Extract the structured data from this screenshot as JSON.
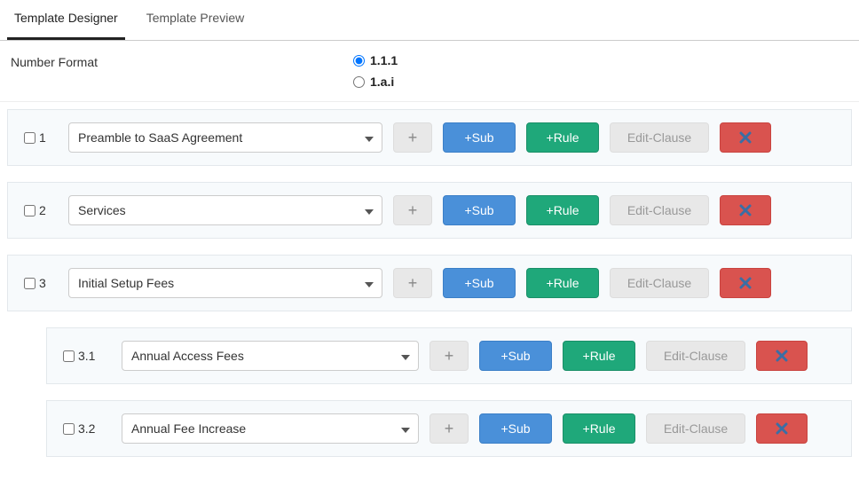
{
  "tabs": {
    "designer": "Template Designer",
    "preview": "Template Preview"
  },
  "numberFormat": {
    "label": "Number Format",
    "opt1": "1.1.1",
    "opt2": "1.a.i"
  },
  "buttons": {
    "plus": "+",
    "sub": "+Sub",
    "rule": "+Rule",
    "edit": "Edit-Clause"
  },
  "clauses": [
    {
      "num": "1",
      "title": "Preamble to SaaS Agreement"
    },
    {
      "num": "2",
      "title": "Services"
    },
    {
      "num": "3",
      "title": "Initial Setup Fees"
    }
  ],
  "subclauses": [
    {
      "num": "3.1",
      "title": "Annual Access Fees"
    },
    {
      "num": "3.2",
      "title": "Annual Fee Increase"
    }
  ]
}
